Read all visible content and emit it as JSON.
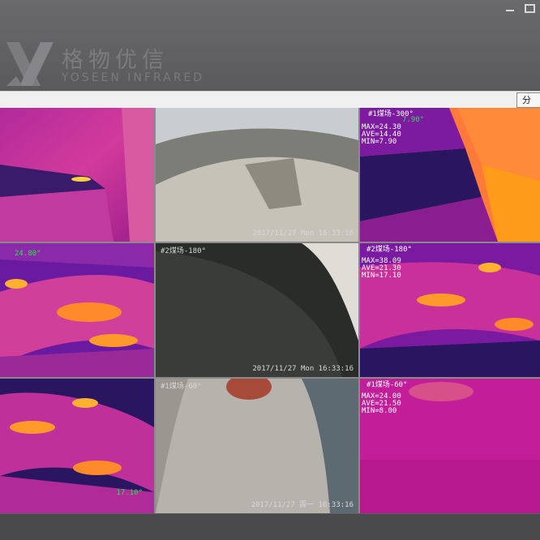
{
  "brand": {
    "cn_name": "格物优信",
    "en_name": "YOSEEN INFRARED"
  },
  "toolbar": {
    "split_label": "分"
  },
  "cameras": [
    {
      "id": "cam-1",
      "type": "thermal",
      "overlays": []
    },
    {
      "id": "cam-2",
      "type": "visible",
      "overlays": [
        {
          "key": "timestamp",
          "text": "2017/11/27 Mon 16:33:16"
        }
      ]
    },
    {
      "id": "cam-3",
      "type": "thermal",
      "overlays": [
        {
          "key": "title",
          "text": "#1煤场-300°"
        },
        {
          "key": "spot",
          "text": "7.90°"
        },
        {
          "key": "max",
          "text": "MAX=24.30"
        },
        {
          "key": "ave",
          "text": "AVE=14.40"
        },
        {
          "key": "min",
          "text": "MIN=7.90"
        }
      ]
    },
    {
      "id": "cam-4",
      "type": "thermal",
      "overlays": [
        {
          "key": "spot",
          "text": "24.80°"
        }
      ]
    },
    {
      "id": "cam-5",
      "type": "visible",
      "overlays": [
        {
          "key": "title",
          "text": "#2煤场-180°"
        },
        {
          "key": "timestamp",
          "text": "2017/11/27 Mon 16:33:16"
        }
      ]
    },
    {
      "id": "cam-6",
      "type": "thermal",
      "overlays": [
        {
          "key": "title",
          "text": "#2煤场-180°"
        },
        {
          "key": "max",
          "text": "MAX=38.09"
        },
        {
          "key": "ave",
          "text": "AVE=21.30"
        },
        {
          "key": "min",
          "text": "MIN=17.10"
        }
      ]
    },
    {
      "id": "cam-7",
      "type": "thermal",
      "overlays": [
        {
          "key": "spot",
          "text": "17.10°"
        }
      ]
    },
    {
      "id": "cam-8",
      "type": "visible",
      "overlays": [
        {
          "key": "title",
          "text": "#1煤场-60°"
        },
        {
          "key": "timestamp",
          "text": "2017/11/27 周一 16:33:16"
        }
      ]
    },
    {
      "id": "cam-9",
      "type": "thermal",
      "overlays": [
        {
          "key": "title",
          "text": "#1煤场-60°"
        },
        {
          "key": "max",
          "text": "MAX=24.00"
        },
        {
          "key": "ave",
          "text": "AVE=21.50"
        },
        {
          "key": "min",
          "text": "MIN=8.00"
        }
      ]
    }
  ],
  "colors": {
    "thermal_cold": "#2a1560",
    "thermal_mid": "#c0209a",
    "thermal_hot": "#ff9a1a",
    "visible_ground": "#b8b5ae",
    "overlay_green": "#3cd85a"
  }
}
